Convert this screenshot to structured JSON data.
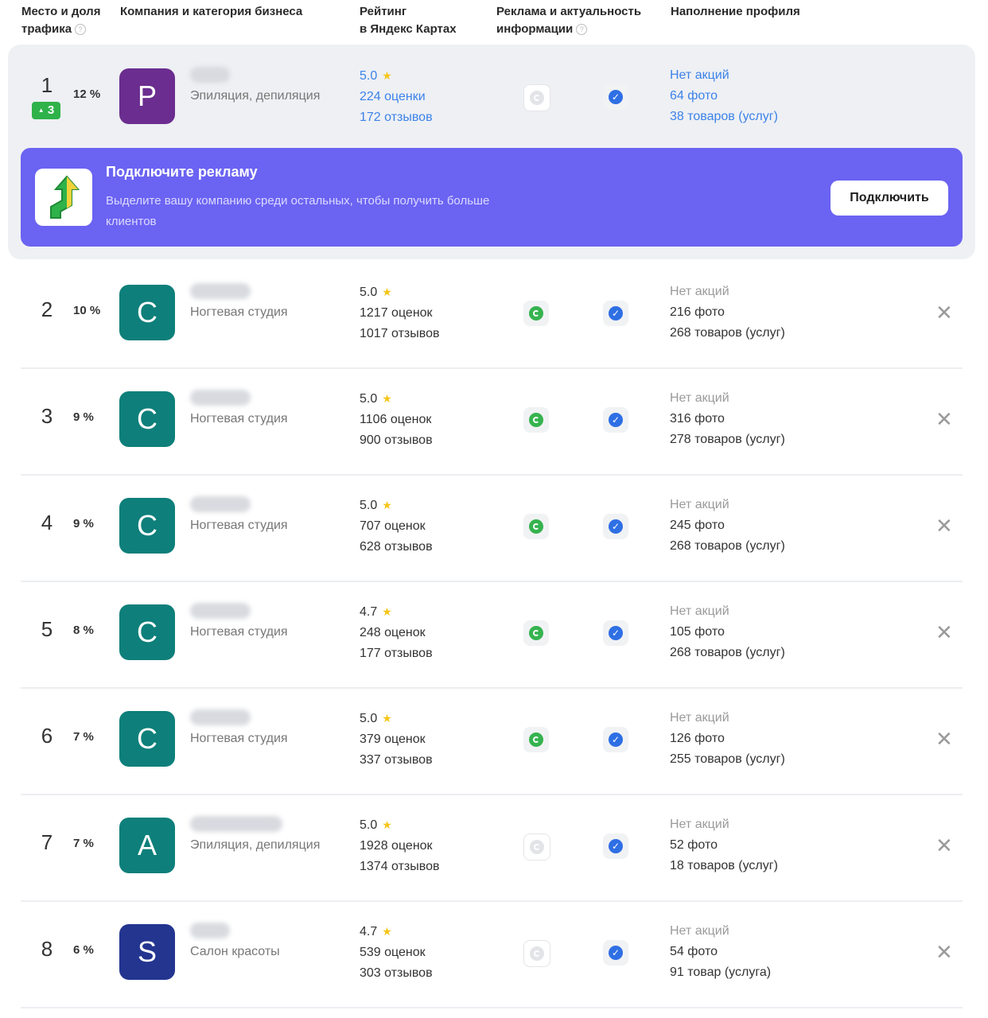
{
  "header": {
    "col_place_line1": "Место и доля",
    "col_place_line2": "трафика",
    "col_company": "Компания и категория бизнеса",
    "col_rating_line1": "Рейтинг",
    "col_rating_line2": "в Яндекс Картах",
    "col_ads_line1": "Реклама и актуальность",
    "col_ads_line2": "информации",
    "col_profile": "Наполнение профиля",
    "help_glyph": "?"
  },
  "promo": {
    "title": "Подключите рекламу",
    "text": "Выделите вашу компанию среди остальных, чтобы получить больше клиентов",
    "button": "Подключить"
  },
  "rows": [
    {
      "place": "1",
      "rise": "3",
      "share": "12 %",
      "letter": "P",
      "avatar_color": "#6b2d8f",
      "category": "Эпиляция, депиляция",
      "rating": "5.0",
      "ratings": "224 оценки",
      "reviews": "172 отзывов",
      "ad_active": false,
      "promo": "Нет акций",
      "photos": "64 фото",
      "goods": "38 товаров (услуг)"
    },
    {
      "place": "2",
      "share": "10 %",
      "letter": "C",
      "avatar_color": "#0e7f7a",
      "category": "Ногтевая студия",
      "rating": "5.0",
      "ratings": "1217 оценок",
      "reviews": "1017 отзывов",
      "ad_active": true,
      "promo": "Нет акций",
      "photos": "216 фото",
      "goods": "268 товаров (услуг)"
    },
    {
      "place": "3",
      "share": "9 %",
      "letter": "C",
      "avatar_color": "#0e7f7a",
      "category": "Ногтевая студия",
      "rating": "5.0",
      "ratings": "1106 оценок",
      "reviews": "900 отзывов",
      "ad_active": true,
      "promo": "Нет акций",
      "photos": "316 фото",
      "goods": "278 товаров (услуг)"
    },
    {
      "place": "4",
      "share": "9 %",
      "letter": "C",
      "avatar_color": "#0e7f7a",
      "category": "Ногтевая студия",
      "rating": "5.0",
      "ratings": "707 оценок",
      "reviews": "628 отзывов",
      "ad_active": true,
      "promo": "Нет акций",
      "photos": "245 фото",
      "goods": "268 товаров (услуг)"
    },
    {
      "place": "5",
      "share": "8 %",
      "letter": "C",
      "avatar_color": "#0e7f7a",
      "category": "Ногтевая студия",
      "rating": "4.7",
      "ratings": "248 оценок",
      "reviews": "177 отзывов",
      "ad_active": true,
      "promo": "Нет акций",
      "photos": "105 фото",
      "goods": "268 товаров (услуг)"
    },
    {
      "place": "6",
      "share": "7 %",
      "letter": "C",
      "avatar_color": "#0e7f7a",
      "category": "Ногтевая студия",
      "rating": "5.0",
      "ratings": "379 оценок",
      "reviews": "337 отзывов",
      "ad_active": true,
      "promo": "Нет акций",
      "photos": "126 фото",
      "goods": "255 товаров (услуг)"
    },
    {
      "place": "7",
      "share": "7 %",
      "letter": "A",
      "avatar_color": "#0e7f7a",
      "category": "Эпиляция, депиляция",
      "rating": "5.0",
      "ratings": "1928 оценок",
      "reviews": "1374 отзывов",
      "ad_active": false,
      "promo": "Нет акций",
      "photos": "52 фото",
      "goods": "18 товаров (услуг)"
    },
    {
      "place": "8",
      "share": "6 %",
      "letter": "S",
      "avatar_color": "#23358f",
      "category": "Салон красоты",
      "rating": "4.7",
      "ratings": "539 оценок",
      "reviews": "303 отзывов",
      "ad_active": false,
      "promo": "Нет акций",
      "photos": "54 фото",
      "goods": "91 товар (услуга)"
    }
  ],
  "icons": {
    "star": "★",
    "close": "✕",
    "check": "✓",
    "rise_arrow": "▲"
  }
}
